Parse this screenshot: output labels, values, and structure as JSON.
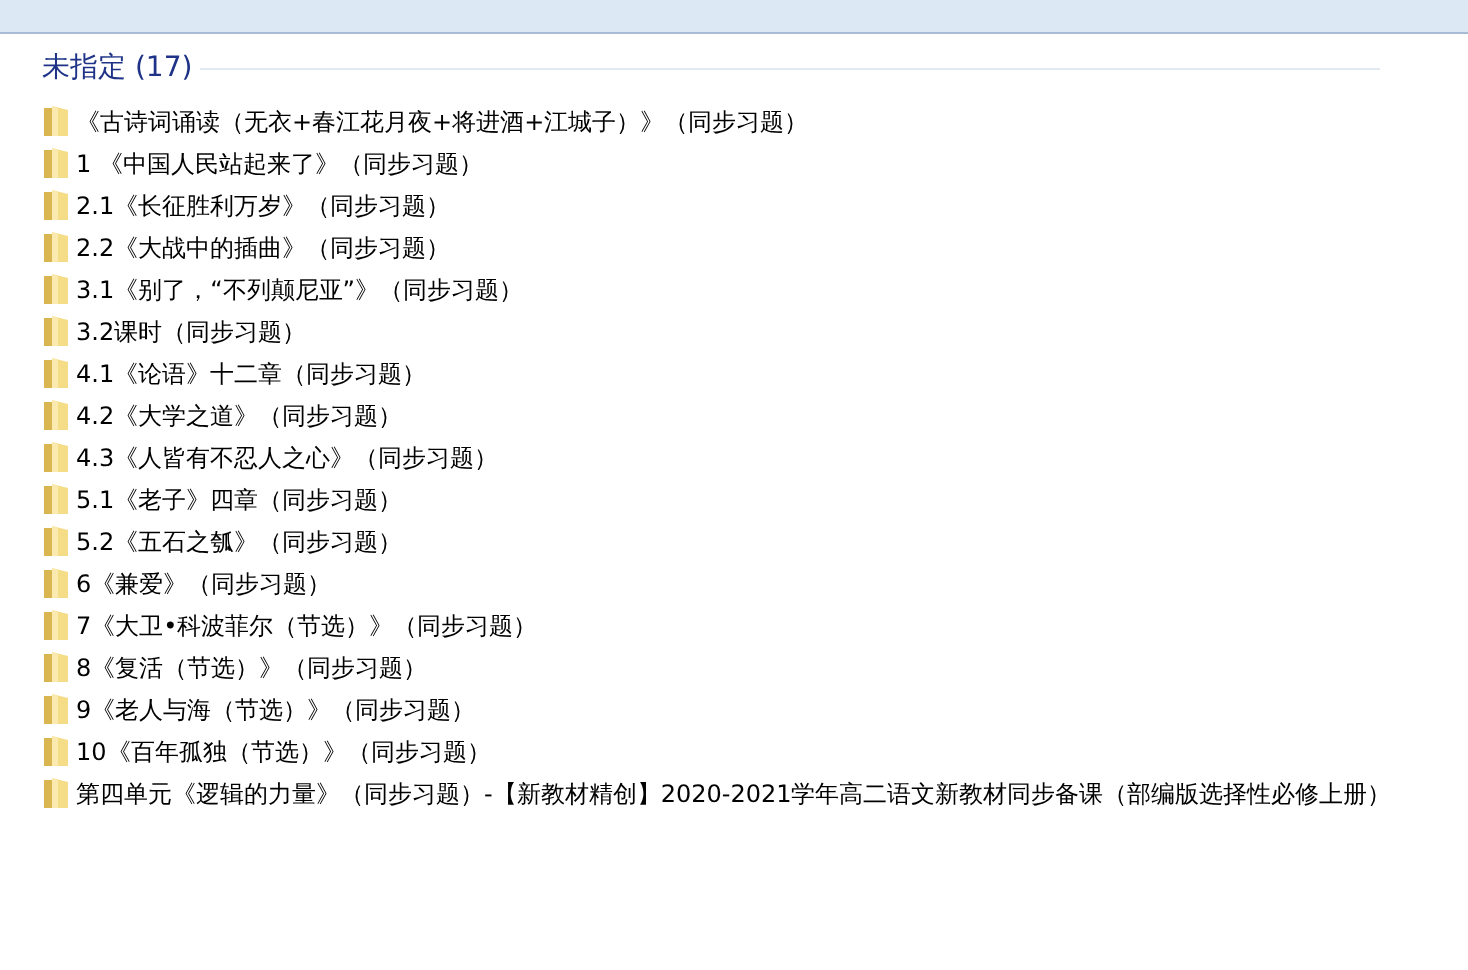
{
  "group": {
    "title": "未指定 (17)",
    "items": [
      {
        "label": "《古诗词诵读（无衣+春江花月夜+将进酒+江城子）》（同步习题）"
      },
      {
        "label": "1 《中国人民站起来了》（同步习题）"
      },
      {
        "label": "2.1《长征胜利万岁》（同步习题）"
      },
      {
        "label": "2.2《大战中的插曲》（同步习题）"
      },
      {
        "label": "3.1《别了，“不列颠尼亚”》（同步习题）"
      },
      {
        "label": "3.2课时（同步习题）"
      },
      {
        "label": "4.1《论语》十二章（同步习题）"
      },
      {
        "label": "4.2《大学之道》（同步习题）"
      },
      {
        "label": "4.3《人皆有不忍人之心》（同步习题）"
      },
      {
        "label": "5.1《老子》四章（同步习题）"
      },
      {
        "label": "5.2《五石之瓠》（同步习题）"
      },
      {
        "label": "6《兼爱》（同步习题）"
      },
      {
        "label": "7《大卫•科波菲尔（节选）》（同步习题）"
      },
      {
        "label": "8《复活（节选）》（同步习题）"
      },
      {
        "label": "9《老人与海（节选）》（同步习题）"
      },
      {
        "label": "10《百年孤独（节选）》（同步习题）"
      },
      {
        "label": "第四单元《逻辑的力量》（同步习题）-【新教材精创】2020-2021学年高二语文新教材同步备课（部编版选择性必修上册）"
      }
    ]
  }
}
